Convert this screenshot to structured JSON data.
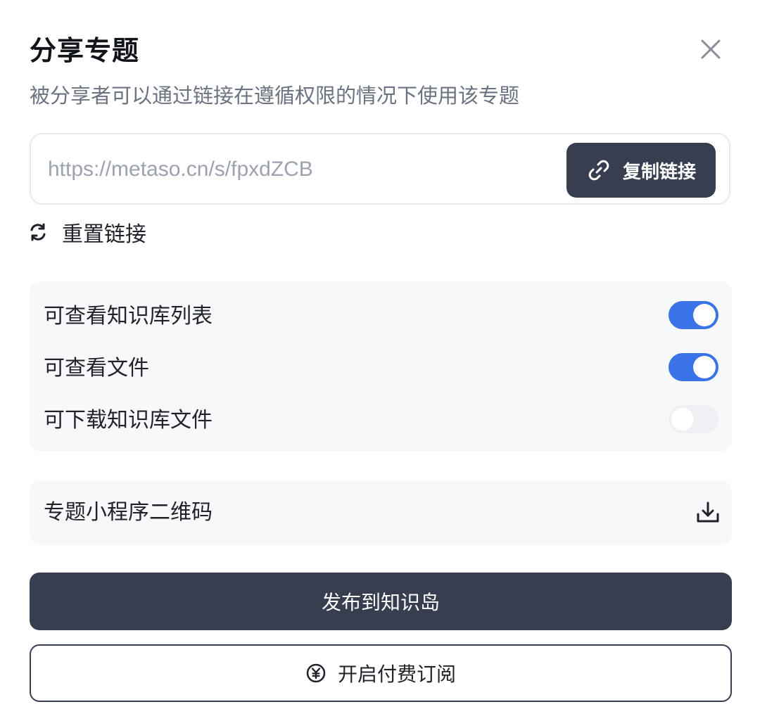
{
  "dialog": {
    "title": "分享专题",
    "subtitle": "被分享者可以通过链接在遵循权限的情况下使用该专题",
    "close_icon": "close-icon"
  },
  "share_link": {
    "url": "https://metaso.cn/s/fpxdZCB",
    "copy_label": "复制链接",
    "copy_icon": "link-icon",
    "reset_label": "重置链接",
    "reset_icon": "refresh-icon"
  },
  "permissions": [
    {
      "label": "可查看知识库列表",
      "enabled": true
    },
    {
      "label": "可查看文件",
      "enabled": true
    },
    {
      "label": "可下载知识库文件",
      "enabled": false
    }
  ],
  "qrcode": {
    "label": "专题小程序二维码",
    "icon": "download-icon"
  },
  "actions": {
    "publish_label": "发布到知识岛",
    "subscribe_label": "开启付费订阅",
    "subscribe_icon": "yuan-icon"
  },
  "colors": {
    "dark_button": "#363e50",
    "toggle_on": "#3a72e8",
    "toggle_off": "#eef0f3",
    "panel_bg": "#f7f8fa"
  }
}
